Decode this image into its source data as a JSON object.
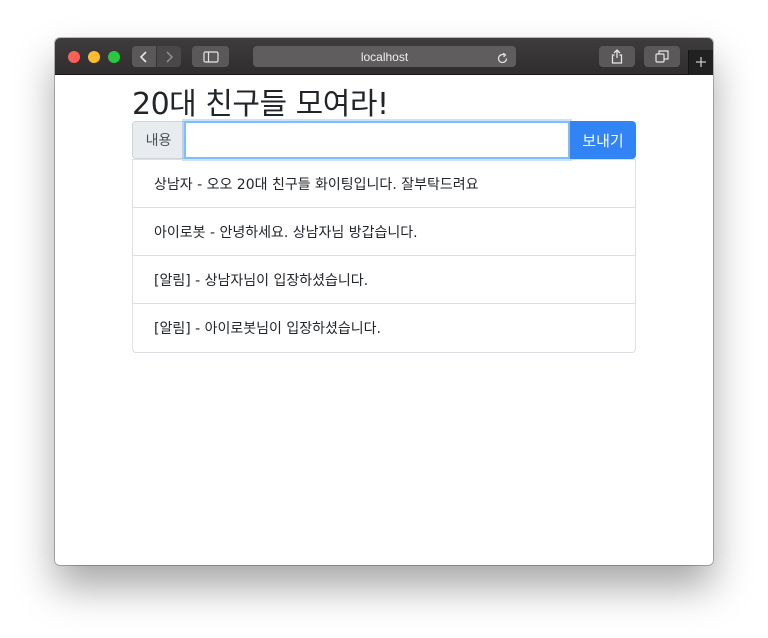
{
  "browser": {
    "address": "localhost",
    "icons": {
      "back": "chevron-left-icon",
      "forward": "chevron-right-icon",
      "sidebar": "sidebar-icon",
      "reload": "reload-icon",
      "share": "share-icon",
      "tabs": "tabs-overview-icon",
      "new_tab": "plus-icon"
    }
  },
  "page": {
    "title": "20대 친구들 모여라!"
  },
  "form": {
    "label": "내용",
    "input_value": "",
    "send_label": "보내기",
    "accent_color": "#3284f5"
  },
  "messages": [
    {
      "text": "상남자 - 오오 20대 친구들 화이팅입니다. 잘부탁드려요"
    },
    {
      "text": "아이로봇 - 안녕하세요. 상남자님 방갑습니다."
    },
    {
      "text": "[알림] - 상남자님이 입장하셨습니다."
    },
    {
      "text": "[알림] - 아이로봇님이 입장하셨습니다."
    }
  ]
}
